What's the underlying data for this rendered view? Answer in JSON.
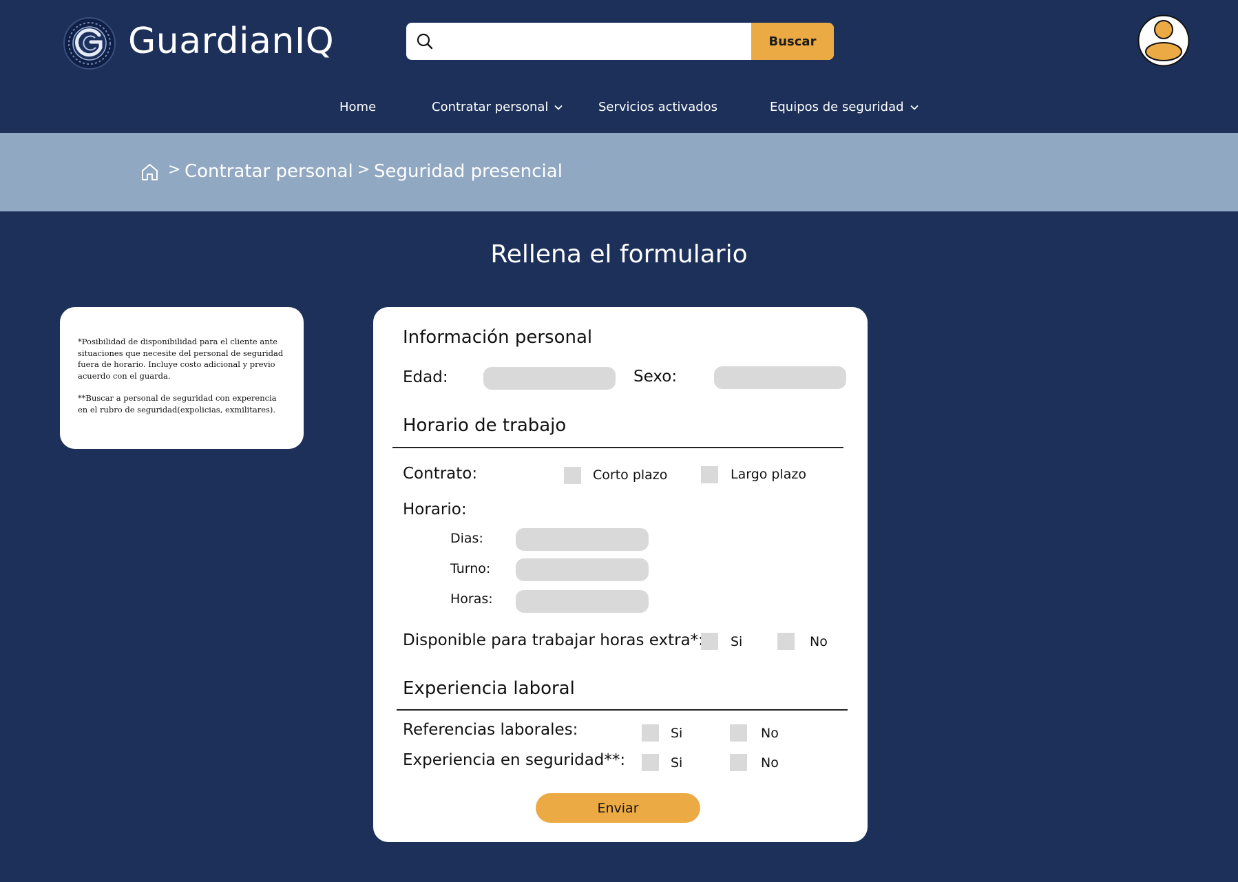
{
  "header": {
    "brand": "GuardianIQ",
    "search": {
      "placeholder": "",
      "button_label": "Buscar"
    }
  },
  "nav": {
    "items": [
      {
        "label": "Home",
        "has_dropdown": false
      },
      {
        "label": "Contratar personal",
        "has_dropdown": true
      },
      {
        "label": "Servicios activados",
        "has_dropdown": false
      },
      {
        "label": "Equipos de seguridad",
        "has_dropdown": true
      }
    ]
  },
  "breadcrumb": {
    "items": [
      "Contratar personal",
      "Seguridad presencial"
    ],
    "separator": ">"
  },
  "page_title": "Rellena el formulario",
  "notes": [
    "*Posibilidad de disponibilidad para el cliente ante situaciones que necesite del personal de seguridad fuera de horario. Incluye costo adicional y previo acuerdo con el guarda.",
    "**Buscar a personal de seguridad con experencia en el rubro de seguridad(expolicias, exmilitares)."
  ],
  "form": {
    "personal_info": {
      "title": "Información personal",
      "age_label": "Edad:",
      "sex_label": "Sexo:"
    },
    "schedule": {
      "title": "Horario de trabajo",
      "contract_label": "Contrato:",
      "contract_options": [
        "Corto plazo",
        "Largo plazo"
      ],
      "schedule_label": "Horario:",
      "days_label": "Dias:",
      "shift_label": "Turno:",
      "hours_label": "Horas:",
      "overtime_label": "Disponible para trabajar horas extra*:",
      "overtime_yes": "Si",
      "overtime_no": "No"
    },
    "experience": {
      "title": "Experiencia laboral",
      "references_label": "Referencias laborales:",
      "security_label": "Experiencia en seguridad**:",
      "yes": "Si",
      "no": "No"
    },
    "submit_label": "Enviar"
  },
  "colors": {
    "background": "#1c3059",
    "breadcrumb_bar": "#91a8c2",
    "accent": "#ecaa44",
    "field": "#d9d9d9"
  }
}
